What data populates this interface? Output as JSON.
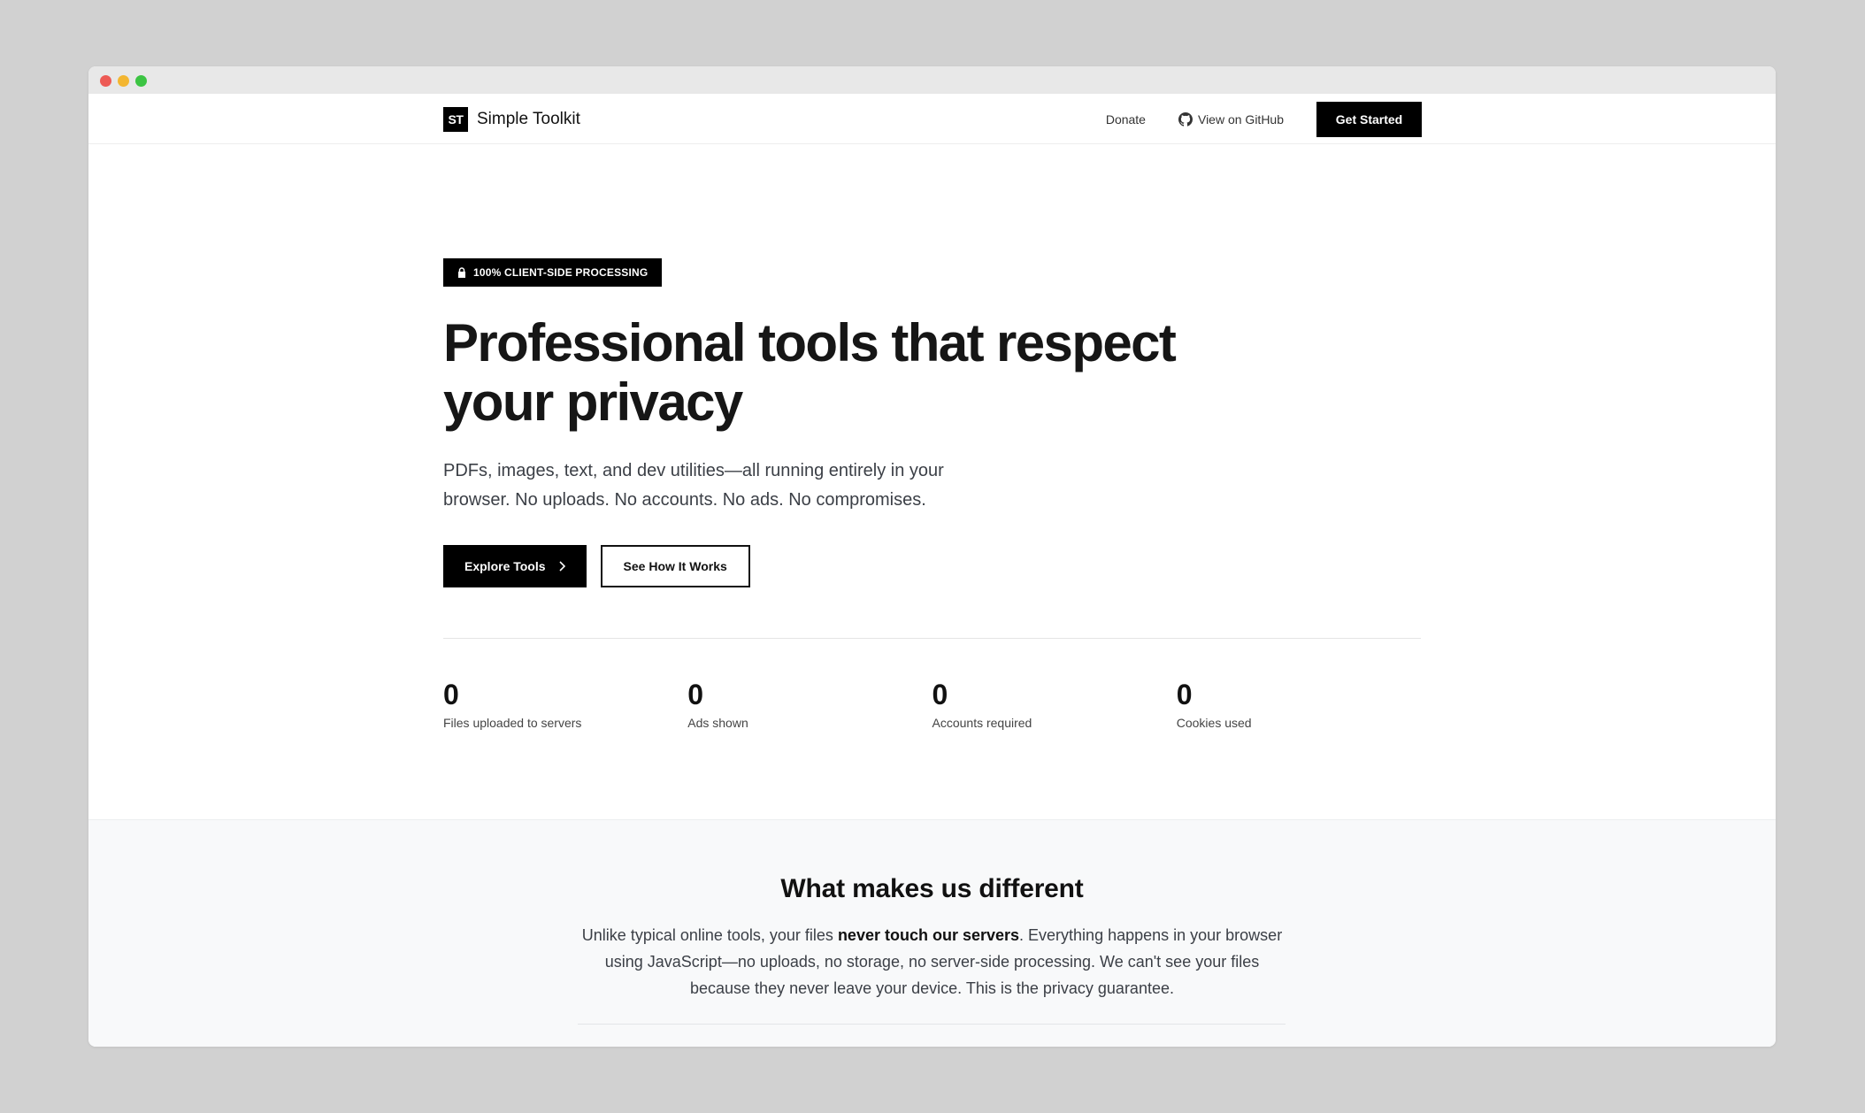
{
  "nav": {
    "logo_mark": "ST",
    "logo_text": "Simple Toolkit",
    "donate": "Donate",
    "github": "View on GitHub",
    "get_started": "Get Started"
  },
  "hero": {
    "badge": "100% CLIENT-SIDE PROCESSING",
    "title_line1": "Professional tools that respect",
    "title_line2": "your privacy",
    "lead": "PDFs, images, text, and dev utilities—all running entirely in your browser. No uploads. No accounts. No ads. No compromises.",
    "explore": "Explore Tools",
    "how": "See How It Works"
  },
  "stats": [
    {
      "value": "0",
      "label": "Files uploaded to servers"
    },
    {
      "value": "0",
      "label": "Ads shown"
    },
    {
      "value": "0",
      "label": "Accounts required"
    },
    {
      "value": "0",
      "label": "Cookies used"
    }
  ],
  "different": {
    "heading": "What makes us different",
    "text_before": "Unlike typical online tools, your files ",
    "text_bold": "never touch our servers",
    "text_after": ". Everything happens in your browser using JavaScript—no uploads, no storage, no server-side processing. We can't see your files because they never leave your device. This is the privacy guarantee."
  },
  "icons": {
    "github": "github-icon",
    "lock": "lock-icon",
    "chevron": "chevron-right-icon"
  }
}
